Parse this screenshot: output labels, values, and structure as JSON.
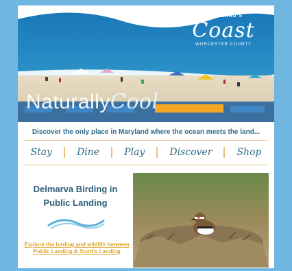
{
  "logo": {
    "top": "MARYLAND'S",
    "name": "Coast",
    "sub": "WORCESTER COUNTY"
  },
  "hero": {
    "headline_a": "Naturally",
    "headline_b": "Cool"
  },
  "tagline": "Discover the only place in Maryland where the ocean meets the land...",
  "nav": [
    {
      "label": "Stay"
    },
    {
      "label": "Dine"
    },
    {
      "label": "Play"
    },
    {
      "label": "Discover"
    },
    {
      "label": "Shop"
    }
  ],
  "feature": {
    "title": "Delmarva Birding in Public Landing",
    "link_text": "Explore the birding and wildlife between Public Landing & Scott's Landing",
    "image": "bird-on-nest-photo"
  },
  "colors": {
    "background": "#6fb6e0",
    "accent_gold": "#e6c27a",
    "text_blue": "#2e6a8a",
    "link_orange": "#e0a22a"
  }
}
